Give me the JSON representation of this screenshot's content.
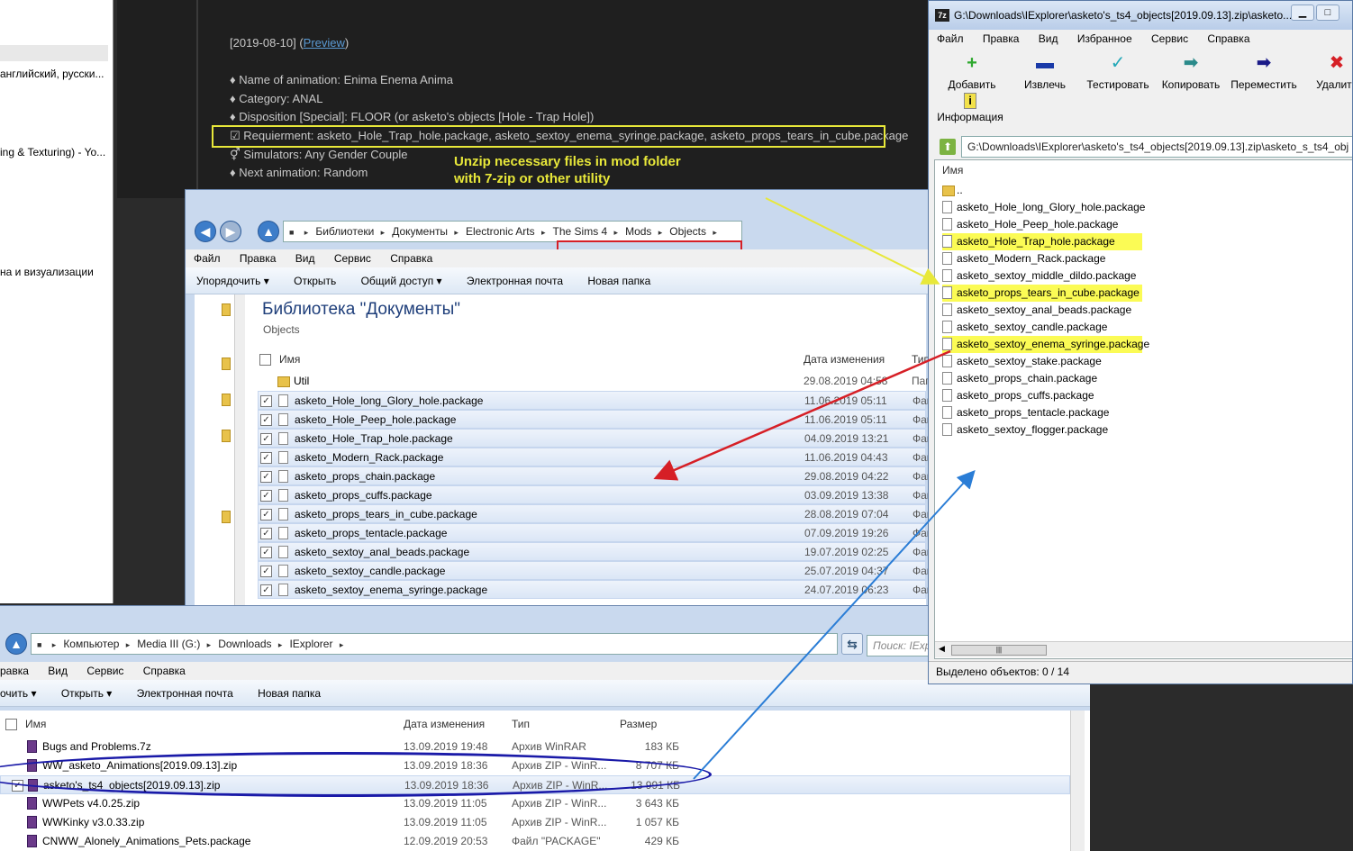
{
  "left_window": {
    "fragments": [
      "английский, русски...",
      "ing & Texturing) - Yo...",
      "на и визуализации"
    ]
  },
  "forum": {
    "date_line": "[2019-08-10] (",
    "preview_link": "Preview",
    "date_line_end": ")",
    "lines": [
      "♦ Name of animation: Enima Enema Anima",
      "♦ Category: ANAL",
      "♦ Disposition [Special]: FLOOR (or asketo's objects [Hole - Trap Hole])",
      "☑ Requierment: asketo_Hole_Trap_hole.package, asketo_sextoy_enema_syringe.package, asketo_props_tears_in_cube.package",
      "⚥ Simulators: Any Gender Couple",
      "♦ Next animation: Random"
    ],
    "annotation_line1": "Unzip necessary files in mod folder",
    "annotation_line2": "with 7-zip or other utility",
    "annotation_color": "#e8e83a"
  },
  "explorer_mid": {
    "breadcrumbs": [
      "Библиотеки",
      "Документы",
      "Electronic Arts",
      "The Sims 4",
      "Mods",
      "Objects"
    ],
    "menu": [
      "Файл",
      "Правка",
      "Вид",
      "Сервис",
      "Справка"
    ],
    "toolbar": [
      "Упорядочить ▾",
      "Открыть",
      "Общий доступ ▾",
      "Электронная почта",
      "Новая папка"
    ],
    "library_title": "Библиотека \"Документы\"",
    "library_sub": "Objects",
    "columns": {
      "name": "Имя",
      "date": "Дата изменения",
      "type": "Тип"
    },
    "rows": [
      {
        "name": "Util",
        "date": "29.08.2019 04:58",
        "type": "Папк",
        "folder": true,
        "checked": false
      },
      {
        "name": "asketo_Hole_long_Glory_hole.package",
        "date": "11.06.2019 05:11",
        "type": "Файл",
        "folder": false,
        "checked": true
      },
      {
        "name": "asketo_Hole_Peep_hole.package",
        "date": "11.06.2019 05:11",
        "type": "Файл",
        "folder": false,
        "checked": true
      },
      {
        "name": "asketo_Hole_Trap_hole.package",
        "date": "04.09.2019 13:21",
        "type": "Файл",
        "folder": false,
        "checked": true
      },
      {
        "name": "asketo_Modern_Rack.package",
        "date": "11.06.2019 04:43",
        "type": "Файл",
        "folder": false,
        "checked": true
      },
      {
        "name": "asketo_props_chain.package",
        "date": "29.08.2019 04:22",
        "type": "Файл",
        "folder": false,
        "checked": true
      },
      {
        "name": "asketo_props_cuffs.package",
        "date": "03.09.2019 13:38",
        "type": "Файл",
        "folder": false,
        "checked": true
      },
      {
        "name": "asketo_props_tears_in_cube.package",
        "date": "28.08.2019 07:04",
        "type": "Файл",
        "folder": false,
        "checked": true
      },
      {
        "name": "asketo_props_tentacle.package",
        "date": "07.09.2019 19:26",
        "type": "Файл",
        "folder": false,
        "checked": true
      },
      {
        "name": "asketo_sextoy_anal_beads.package",
        "date": "19.07.2019 02:25",
        "type": "Файл",
        "folder": false,
        "checked": true
      },
      {
        "name": "asketo_sextoy_candle.package",
        "date": "25.07.2019 04:37",
        "type": "Файл",
        "folder": false,
        "checked": true
      },
      {
        "name": "asketo_sextoy_enema_syringe.package",
        "date": "24.07.2019 06:23",
        "type": "Файл",
        "folder": false,
        "checked": true
      }
    ]
  },
  "explorer_bot": {
    "breadcrumbs": [
      "Компьютер",
      "Media III (G:)",
      "Downloads",
      "IExplorer"
    ],
    "search_placeholder": "Поиск: IExp",
    "menu": [
      "равка",
      "Вид",
      "Сервис",
      "Справка"
    ],
    "toolbar": [
      "очить ▾",
      "Открыть ▾",
      "Электронная почта",
      "Новая папка"
    ],
    "columns": {
      "name": "Имя",
      "date": "Дата изменения",
      "type": "Тип",
      "size": "Размер"
    },
    "rows": [
      {
        "name": "Bugs and Problems.7z",
        "date": "13.09.2019 19:48",
        "type": "Архив WinRAR",
        "size": "183 КБ",
        "checked": false
      },
      {
        "name": "WW_asketo_Animations[2019.09.13].zip",
        "date": "13.09.2019 18:36",
        "type": "Архив ZIP - WinR...",
        "size": "8 707 КБ",
        "checked": false
      },
      {
        "name": "asketo's_ts4_objects[2019.09.13].zip",
        "date": "13.09.2019 18:36",
        "type": "Архив ZIP - WinR...",
        "size": "13 991 КБ",
        "checked": true
      },
      {
        "name": "WWPets v4.0.25.zip",
        "date": "13.09.2019 11:05",
        "type": "Архив ZIP - WinR...",
        "size": "3 643 КБ",
        "checked": false
      },
      {
        "name": "WWKinky v3.0.33.zip",
        "date": "13.09.2019 11:05",
        "type": "Архив ZIP - WinR...",
        "size": "1 057 КБ",
        "checked": false
      },
      {
        "name": "CNWW_Alonely_Animations_Pets.package",
        "date": "12.09.2019 20:53",
        "type": "Файл \"PACKAGE\"",
        "size": "429 КБ",
        "checked": false
      }
    ],
    "right_fragment": "МБ"
  },
  "zip": {
    "logo": "7z",
    "title": "G:\\Downloads\\IExplorer\\asketo's_ts4_objects[2019.09.13].zip\\asketo...",
    "menu": [
      "Файл",
      "Правка",
      "Вид",
      "Избранное",
      "Сервис",
      "Справка"
    ],
    "toolbar": [
      {
        "label": "Добавить",
        "icon": "plus-icon",
        "glyph": "+",
        "color": "#2ea82e"
      },
      {
        "label": "Извлечь",
        "icon": "minus-icon",
        "glyph": "▬",
        "color": "#1a3aa8"
      },
      {
        "label": "Тестировать",
        "icon": "check-icon",
        "glyph": "✓",
        "color": "#23a8b8"
      },
      {
        "label": "Копировать",
        "icon": "copy-arrow-icon",
        "glyph": "➡",
        "color": "#2a8a8a"
      },
      {
        "label": "Переместить",
        "icon": "move-arrow-icon",
        "glyph": "➡",
        "color": "#1a1a88"
      },
      {
        "label": "Удалить",
        "icon": "delete-icon",
        "glyph": "✖",
        "color": "#d61f26"
      }
    ],
    "info_label": "Информация",
    "path": "G:\\Downloads\\IExplorer\\asketo's_ts4_objects[2019.09.13].zip\\asketo_s_ts4_obj",
    "column_name": "Имя",
    "rows": [
      {
        "name": "..",
        "folder": true,
        "hl": false
      },
      {
        "name": "asketo_Hole_long_Glory_hole.package",
        "folder": false,
        "hl": false
      },
      {
        "name": "asketo_Hole_Peep_hole.package",
        "folder": false,
        "hl": false
      },
      {
        "name": "asketo_Hole_Trap_hole.package",
        "folder": false,
        "hl": true
      },
      {
        "name": "asketo_Modern_Rack.package",
        "folder": false,
        "hl": false
      },
      {
        "name": "asketo_sextoy_middle_dildo.package",
        "folder": false,
        "hl": false
      },
      {
        "name": "asketo_props_tears_in_cube.package",
        "folder": false,
        "hl": true
      },
      {
        "name": "asketo_sextoy_anal_beads.package",
        "folder": false,
        "hl": false
      },
      {
        "name": "asketo_sextoy_candle.package",
        "folder": false,
        "hl": false
      },
      {
        "name": "asketo_sextoy_enema_syringe.package",
        "folder": false,
        "hl": true
      },
      {
        "name": "asketo_sextoy_stake.package",
        "folder": false,
        "hl": false
      },
      {
        "name": "asketo_props_chain.package",
        "folder": false,
        "hl": false
      },
      {
        "name": "asketo_props_cuffs.package",
        "folder": false,
        "hl": false
      },
      {
        "name": "asketo_props_tentacle.package",
        "folder": false,
        "hl": false
      },
      {
        "name": "asketo_sextoy_flogger.package",
        "folder": false,
        "hl": false
      }
    ],
    "status": "Выделено объектов: 0 / 14"
  }
}
